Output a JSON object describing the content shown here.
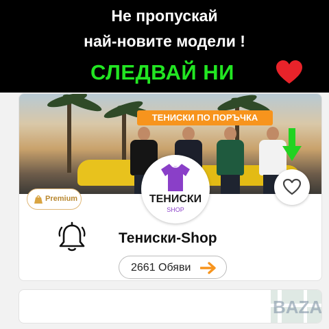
{
  "banner": {
    "line1": "Не пропускай",
    "line2": "най-новите модели !",
    "follow": "СЛЕДВАЙ НИ",
    "heart_icon": "heart-icon",
    "follow_color": "#22e622",
    "heart_color": "#e8232a"
  },
  "profile": {
    "cover_promo": "ТЕНИСКИ ПО ПОРЪЧКА",
    "logo_title": "ТЕНИСКИ",
    "logo_subtitle": "SHOP",
    "premium_label": "Premium",
    "shop_name": "Тениски-Shop",
    "ads_button": "2661 Обяви",
    "favorite_icon": "heart-outline-icon",
    "notification_icon": "bell-icon",
    "arrow_icon": "arrow-right-icon",
    "accent_color": "#f7941d"
  },
  "watermark": "BAZAR"
}
